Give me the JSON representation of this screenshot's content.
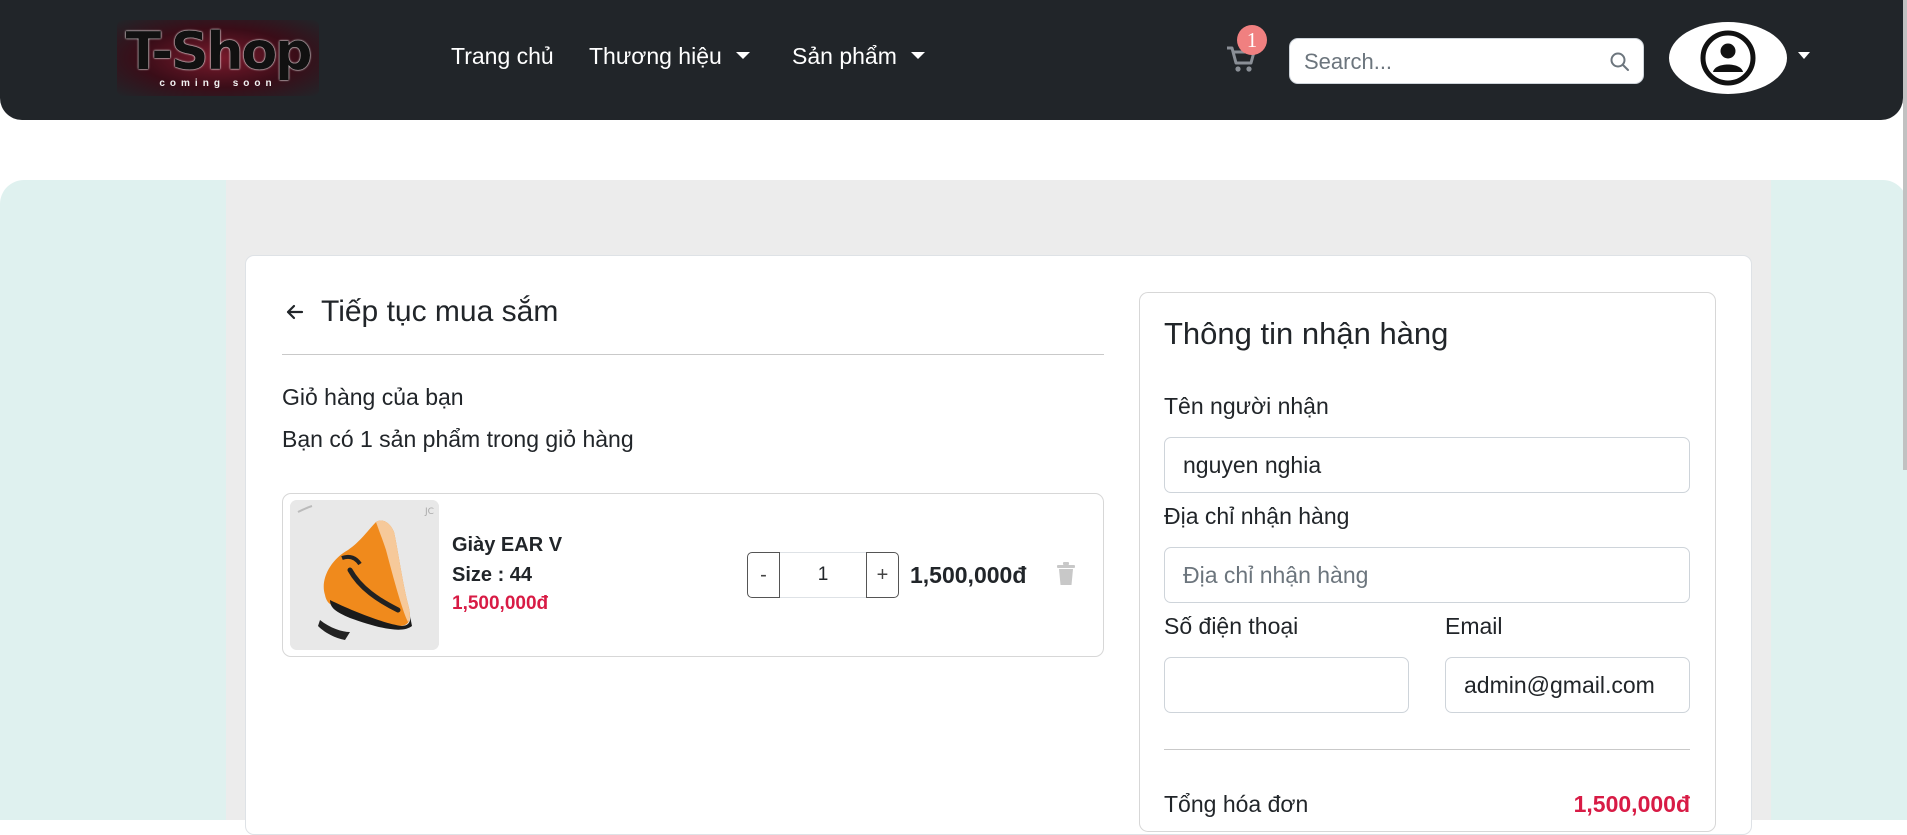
{
  "navbar": {
    "logo_text": "T-Shop",
    "logo_tagline": "coming soon",
    "nav_items": [
      {
        "label": "Trang chủ"
      },
      {
        "label": "Thương hiệu"
      },
      {
        "label": "Sản phẩm"
      }
    ],
    "cart_count": "1",
    "search_placeholder": "Search...",
    "colors": {
      "background": "#212529",
      "badge": "#f08080"
    }
  },
  "cart": {
    "back_label": "Tiếp tục mua sắm",
    "title": "Giỏ hàng của bạn",
    "count_text": "Bạn có 1 sản phẩm trong giỏ hàng",
    "items": [
      {
        "name": "Giày EAR V",
        "size": "Size : 44",
        "price": "1,500,000đ",
        "quantity": "1",
        "minus_label": "-",
        "plus_label": "+",
        "total": "1,500,000đ"
      }
    ]
  },
  "shipping_form": {
    "title": "Thông tin nhận hàng",
    "name_label": "Tên người nhận",
    "name_value": "nguyen nghia",
    "address_label": "Địa chỉ nhận hàng",
    "address_placeholder": "Địa chỉ nhận hàng",
    "phone_label": "Số điện thoại",
    "phone_value": "",
    "email_label": "Email",
    "email_value": "admin@gmail.com",
    "total_label": "Tổng hóa đơn",
    "total_value": "1,500,000đ"
  },
  "colors": {
    "accent_price": "#d81b45",
    "page_mint": "#dff1ef",
    "page_grey": "#ececec"
  }
}
